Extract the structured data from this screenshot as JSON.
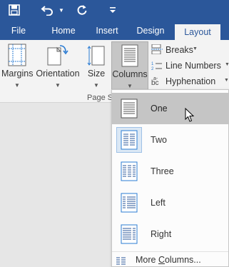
{
  "colors": {
    "brand": "#2b579a",
    "ribbon": "#f3f3f3",
    "hover": "#c5c5c5",
    "selected": "#dbe8f5"
  },
  "quick_access": {
    "icons": [
      "save-icon",
      "undo-icon",
      "redo-icon",
      "customize-icon"
    ]
  },
  "tabs": [
    {
      "label": "File"
    },
    {
      "label": "Home"
    },
    {
      "label": "Insert"
    },
    {
      "label": "Design"
    },
    {
      "label": "Layout",
      "active": true
    }
  ],
  "ribbon": {
    "margins": "Margins",
    "orientation": "Orientation",
    "size": "Size",
    "columns": "Columns",
    "breaks": "Breaks",
    "line_numbers": "Line Numbers",
    "hyphenation": "Hyphenation",
    "group_label": "Page S"
  },
  "columns_menu": {
    "items": [
      {
        "label": "One",
        "hovered": true
      },
      {
        "label": "Two",
        "selected": true
      },
      {
        "label": "Three"
      },
      {
        "label": "Left"
      },
      {
        "label": "Right"
      }
    ],
    "more_prefix": "More ",
    "more_underlined": "C",
    "more_suffix": "olumns..."
  }
}
